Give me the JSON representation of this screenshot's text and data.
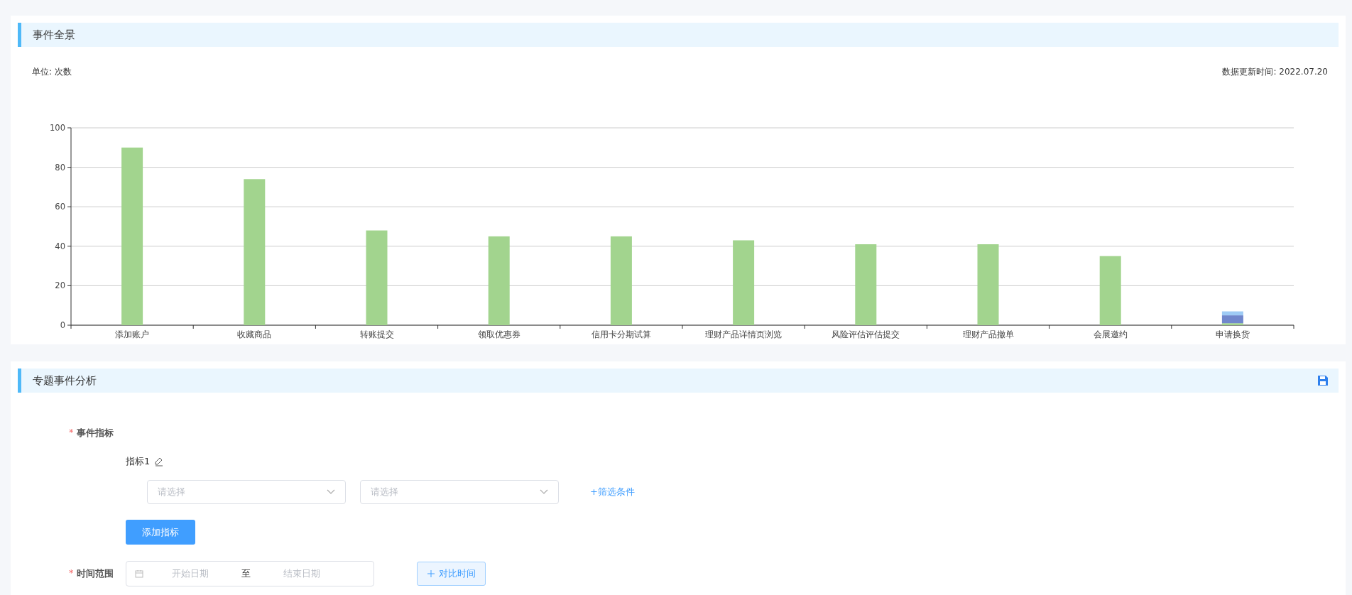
{
  "overview": {
    "title": "事件全景",
    "unit": "单位: 次数",
    "updated": "数据更新时间: 2022.07.20",
    "chart_data": {
      "type": "bar",
      "stacked": true,
      "categories": [
        "添加账户",
        "收藏商品",
        "转账提交",
        "领取优惠券",
        "信用卡分期试算",
        "理财产品详情页浏览",
        "风险评估评估提交",
        "理财产品撤单",
        "会展邀约",
        "申请换货"
      ],
      "series": [
        {
          "color": "#a2d48e",
          "values": [
            90,
            74,
            48,
            45,
            45,
            43,
            41,
            41,
            35,
            1
          ]
        },
        {
          "color": "#7087cc",
          "values": [
            0,
            0,
            0,
            0,
            0,
            0,
            0,
            0,
            0,
            4
          ]
        },
        {
          "color": "#9ecbf5",
          "values": [
            0,
            0,
            0,
            0,
            0,
            0,
            0,
            0,
            0,
            2
          ]
        }
      ],
      "ylim": [
        0,
        100
      ],
      "grid": true,
      "yticks": [
        0,
        20,
        40,
        60,
        80,
        100
      ]
    }
  },
  "analysis": {
    "title": "专题事件分析",
    "metric": {
      "label": "事件指标",
      "required_mark": "*",
      "name": "指标1",
      "selects": [
        {
          "placeholder": "请选择"
        },
        {
          "placeholder": "请选择"
        }
      ],
      "filter_link": "+筛选条件",
      "add_button": "添加指标"
    },
    "time": {
      "label": "时间范围",
      "required_mark": "*",
      "start_placeholder": "开始日期",
      "separator": "至",
      "end_placeholder": "结束日期",
      "compare_button": "对比时间"
    }
  }
}
